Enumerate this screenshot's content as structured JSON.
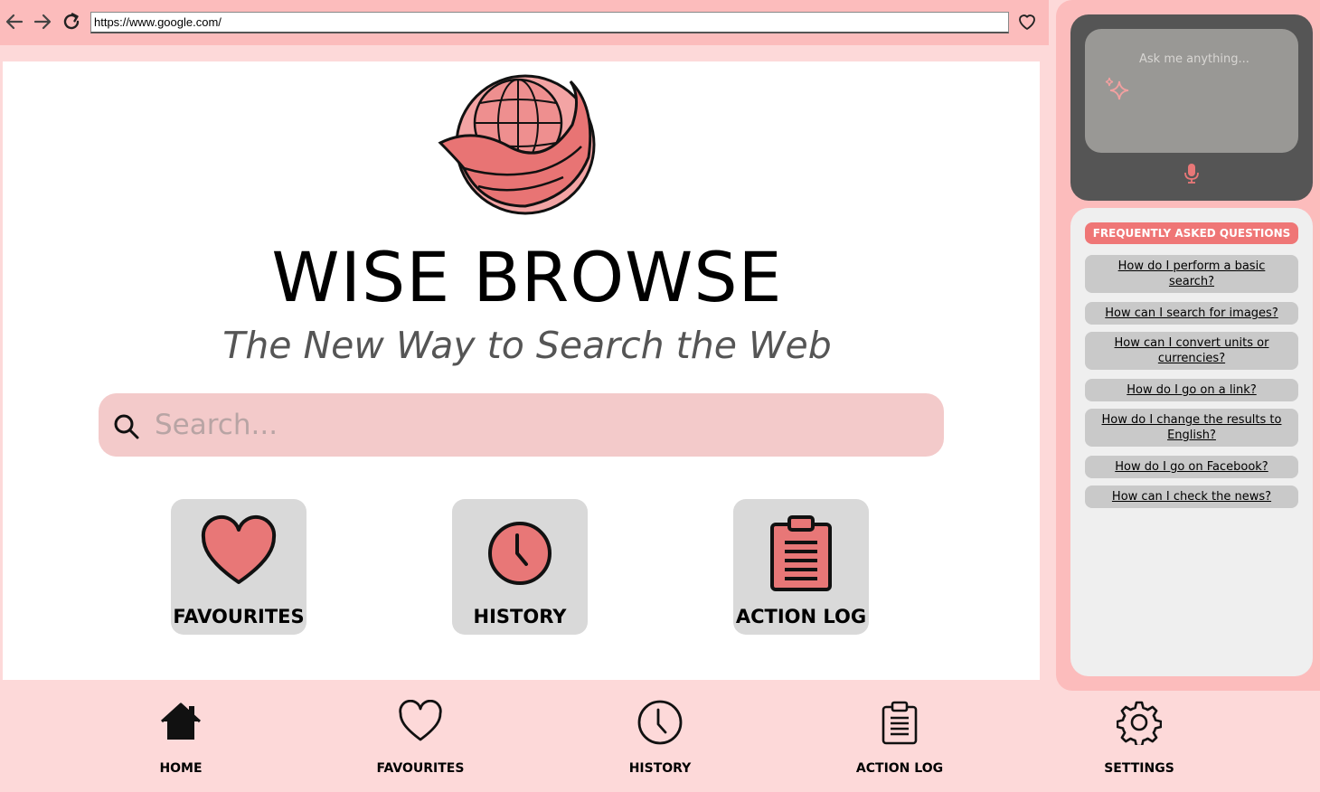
{
  "browser": {
    "url": "https://www.google.com/"
  },
  "main": {
    "title": "WISE BROWSE",
    "subtitle": "The New Way to Search the Web",
    "search_placeholder": "Search...",
    "tiles": [
      {
        "label": "FAVOURITES",
        "icon": "heart-icon"
      },
      {
        "label": "HISTORY",
        "icon": "clock-icon"
      },
      {
        "label": "ACTION LOG",
        "icon": "clipboard-icon"
      }
    ]
  },
  "assistant": {
    "placeholder": "Ask me anything..."
  },
  "faq": {
    "header": "FREQUENTLY ASKED QUESTIONS",
    "items": [
      "How do I perform a basic search?",
      "How can I search for images?",
      "How can I convert units or currencies?",
      "How do I go on a link?",
      "How do I change the results to English?",
      "How do I go on Facebook?",
      "How can I check the news?"
    ]
  },
  "bottom_nav": [
    {
      "label": "HOME",
      "icon": "home-icon"
    },
    {
      "label": "FAVOURITES",
      "icon": "heart-icon"
    },
    {
      "label": "HISTORY",
      "icon": "clock-icon"
    },
    {
      "label": "ACTION LOG",
      "icon": "clipboard-icon"
    },
    {
      "label": "SETTINGS",
      "icon": "gear-icon"
    }
  ],
  "colors": {
    "accent": "#ef7676",
    "background": "#fdd9d9",
    "bar": "#fcbcbc",
    "tile": "#d9d9d9",
    "icon_fill": "#e87777"
  }
}
